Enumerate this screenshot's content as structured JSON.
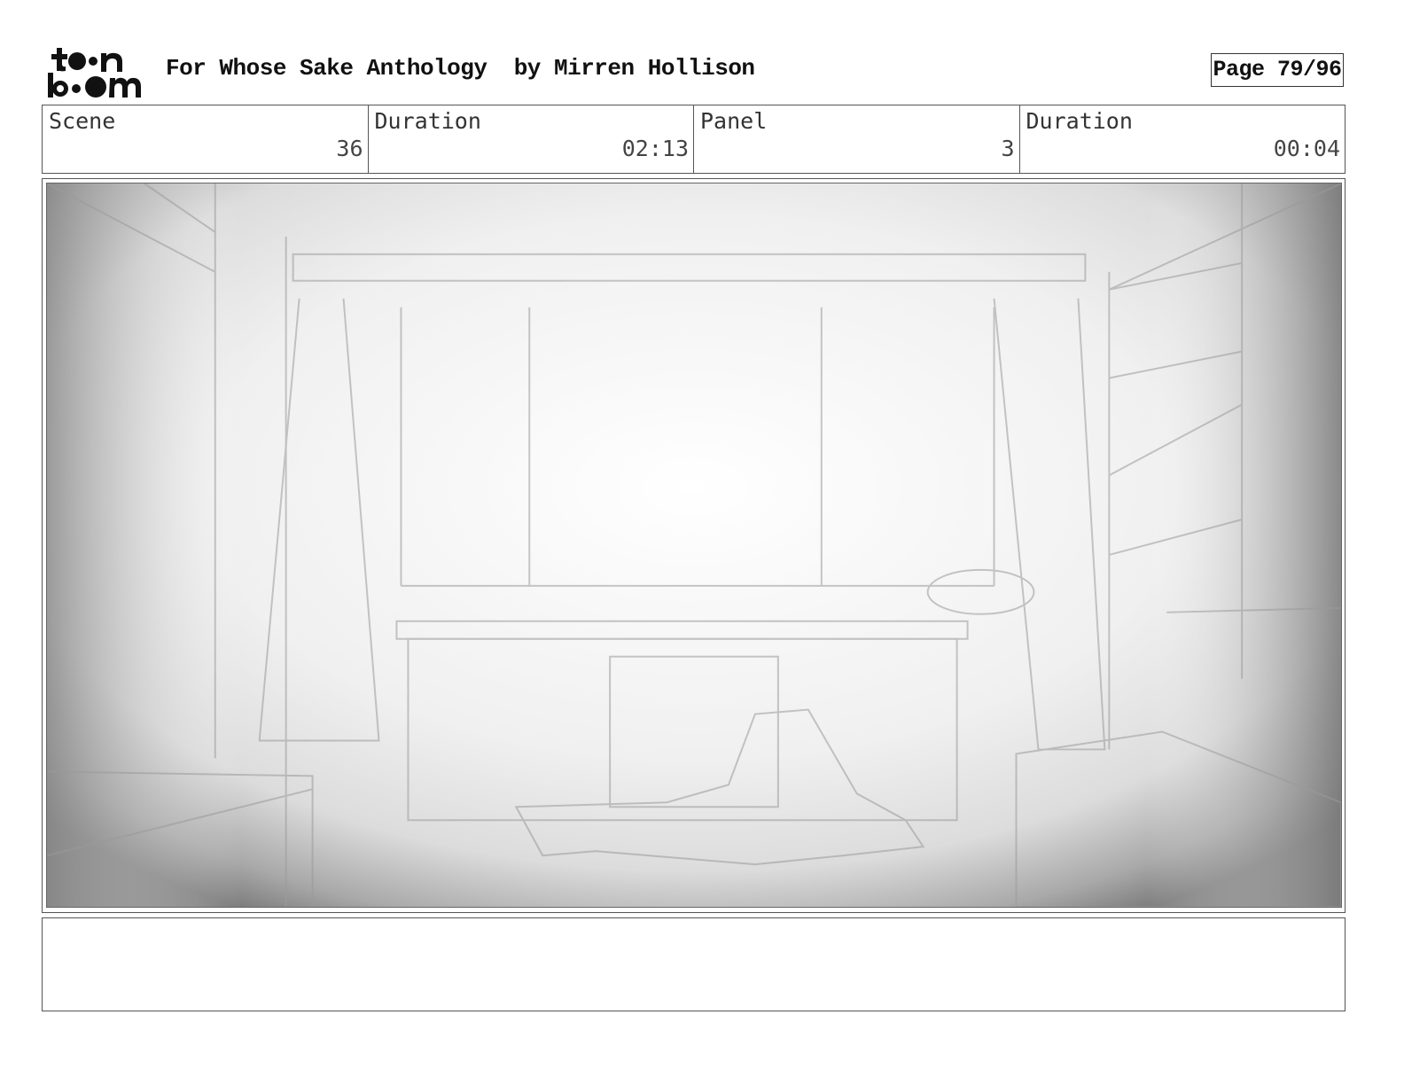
{
  "header": {
    "logo_text": "toon boom",
    "title": "For Whose Sake Anthology",
    "author": "by Mirren Hollison",
    "page_label": "Page 79/96"
  },
  "info": {
    "scene_label": "Scene",
    "scene_value": "36",
    "scene_duration_label": "Duration",
    "scene_duration_value": "02:13",
    "panel_label": "Panel",
    "panel_value": "3",
    "panel_duration_label": "Duration",
    "panel_duration_value": "00:04"
  },
  "notes": {
    "text": ""
  }
}
